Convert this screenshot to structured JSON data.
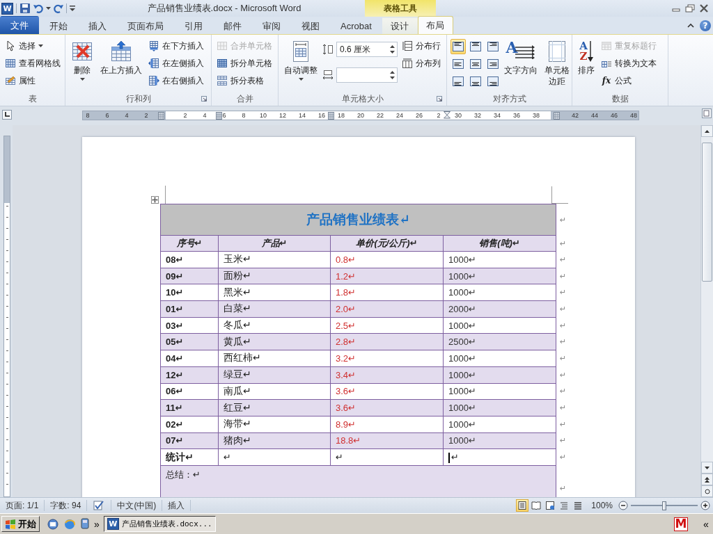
{
  "title_bar": {
    "app_icon": "W",
    "title": "产品销售业绩表.docx - Microsoft Word",
    "context_label": "表格工具"
  },
  "tabs": [
    {
      "label": "文件",
      "kind": "file",
      "selected": false
    },
    {
      "label": "开始",
      "kind": "main",
      "selected": false
    },
    {
      "label": "插入",
      "kind": "main",
      "selected": false
    },
    {
      "label": "页面布局",
      "kind": "main",
      "selected": false
    },
    {
      "label": "引用",
      "kind": "main",
      "selected": false
    },
    {
      "label": "邮件",
      "kind": "main",
      "selected": false
    },
    {
      "label": "审阅",
      "kind": "main",
      "selected": false
    },
    {
      "label": "视图",
      "kind": "main",
      "selected": false
    },
    {
      "label": "Acrobat",
      "kind": "main",
      "selected": false
    },
    {
      "label": "设计",
      "kind": "context",
      "selected": false
    },
    {
      "label": "布局",
      "kind": "context",
      "selected": true
    }
  ],
  "help_glyph": "?",
  "ribbon": {
    "groups": [
      {
        "label": "表",
        "launcher": false,
        "columns": [
          [
            {
              "kind": "small",
              "label": "选择",
              "dropdown": true,
              "disabled": false
            },
            {
              "kind": "small",
              "label": "查看网格线",
              "dropdown": false,
              "disabled": false
            },
            {
              "kind": "small",
              "label": "属性",
              "dropdown": false,
              "disabled": false
            }
          ]
        ]
      },
      {
        "label": "行和列",
        "launcher": true,
        "columns": [
          [
            {
              "kind": "large",
              "label": "删除",
              "dropdown": true,
              "disabled": false
            }
          ],
          [
            {
              "kind": "large",
              "label": "在上方插入",
              "dropdown": false,
              "disabled": false
            }
          ],
          [
            {
              "kind": "small",
              "label": "在下方插入",
              "dropdown": false,
              "disabled": false
            },
            {
              "kind": "small",
              "label": "在左侧插入",
              "dropdown": false,
              "disabled": false
            },
            {
              "kind": "small",
              "label": "在右侧插入",
              "dropdown": false,
              "disabled": false
            }
          ]
        ]
      },
      {
        "label": "合并",
        "launcher": false,
        "columns": [
          [
            {
              "kind": "small",
              "label": "合并单元格",
              "dropdown": false,
              "disabled": true
            },
            {
              "kind": "small",
              "label": "拆分单元格",
              "dropdown": false,
              "disabled": false
            },
            {
              "kind": "small",
              "label": "拆分表格",
              "dropdown": false,
              "disabled": false
            }
          ]
        ]
      },
      {
        "label": "单元格大小",
        "launcher": true,
        "columns": [
          [
            {
              "kind": "large",
              "label": "自动调整",
              "dropdown": true,
              "disabled": false
            }
          ],
          [
            {
              "kind": "spin",
              "value": "0.6 厘米"
            },
            {
              "kind": "spin"
            }
          ],
          [
            {
              "kind": "small",
              "label": "分布行",
              "dropdown": false,
              "disabled": false
            },
            {
              "kind": "small",
              "label": "分布列",
              "dropdown": false,
              "disabled": false
            }
          ]
        ]
      },
      {
        "label": "对齐方式",
        "launcher": false,
        "columns": [
          [
            {
              "kind": "align-grid",
              "cells": [
                {
                  "selected": true
                },
                {
                  "selected": false
                },
                {
                  "selected": false
                },
                {
                  "selected": false
                },
                {
                  "selected": false
                },
                {
                  "selected": false
                },
                {
                  "selected": false
                },
                {
                  "selected": false
                },
                {
                  "selected": false
                }
              ]
            }
          ],
          [
            {
              "kind": "large",
              "label": "文字方向",
              "glyphs": [
                "A"
              ],
              "dropdown": false,
              "disabled": false
            }
          ],
          [
            {
              "kind": "large",
              "label": "单元格边距",
              "dropdown": false,
              "disabled": false
            }
          ]
        ]
      },
      {
        "label": "数据",
        "launcher": false,
        "columns": [
          [
            {
              "kind": "large",
              "label": "排序",
              "glyphs": [
                "A",
                "Z"
              ],
              "dropdown": false,
              "disabled": false
            }
          ],
          [
            {
              "kind": "small",
              "label": "重复标题行",
              "dropdown": false,
              "disabled": true
            },
            {
              "kind": "small",
              "label": "转换为文本",
              "dropdown": false,
              "disabled": false
            },
            {
              "kind": "small",
              "label": "公式",
              "glyphs": [
                "fx"
              ],
              "dropdown": false,
              "disabled": false
            }
          ]
        ]
      }
    ]
  },
  "ruler": {
    "labels": [
      "8",
      "6",
      "4",
      "2",
      "2",
      "4",
      "6",
      "8",
      "10",
      "12",
      "14",
      "16",
      "18",
      "20",
      "22",
      "24",
      "26",
      "2",
      "30",
      "32",
      "34",
      "36",
      "38",
      "42",
      "44",
      "46",
      "48"
    ]
  },
  "document": {
    "table": {
      "title": {
        "text": "产品销售业绩表↵",
        "end_mark": "↵"
      },
      "header": {
        "cells": [
          "序号↵",
          "产品↵",
          "单价(元/公斤)↵",
          "销售(吨)↵"
        ],
        "end_mark": "↵"
      },
      "rows": [
        {
          "cells": [
            "08↵",
            "玉米↵",
            "0.8↵",
            "1000↵"
          ],
          "shaded": false,
          "end_mark": "↵"
        },
        {
          "cells": [
            "09↵",
            "面粉↵",
            "1.2↵",
            "1000↵"
          ],
          "shaded": true,
          "end_mark": "↵"
        },
        {
          "cells": [
            "10↵",
            "黑米↵",
            "1.8↵",
            "1000↵"
          ],
          "shaded": false,
          "end_mark": "↵"
        },
        {
          "cells": [
            "01↵",
            "白菜↵",
            "2.0↵",
            "2000↵"
          ],
          "shaded": true,
          "end_mark": "↵"
        },
        {
          "cells": [
            "03↵",
            "冬瓜↵",
            "2.5↵",
            "1000↵"
          ],
          "shaded": false,
          "end_mark": "↵"
        },
        {
          "cells": [
            "05↵",
            "黄瓜↵",
            "2.8↵",
            "2500↵"
          ],
          "shaded": true,
          "end_mark": "↵"
        },
        {
          "cells": [
            "04↵",
            "西红柿↵",
            "3.2↵",
            "1000↵"
          ],
          "shaded": false,
          "end_mark": "↵"
        },
        {
          "cells": [
            "12↵",
            "绿豆↵",
            "3.4↵",
            "1000↵"
          ],
          "shaded": true,
          "end_mark": "↵"
        },
        {
          "cells": [
            "06↵",
            "南瓜↵",
            "3.6↵",
            "1000↵"
          ],
          "shaded": false,
          "end_mark": "↵"
        },
        {
          "cells": [
            "11↵",
            "红豆↵",
            "3.6↵",
            "1000↵"
          ],
          "shaded": true,
          "end_mark": "↵"
        },
        {
          "cells": [
            "02↵",
            "海带↵",
            "8.9↵",
            "1000↵"
          ],
          "shaded": false,
          "end_mark": "↵"
        },
        {
          "cells": [
            "07↵",
            "猪肉↵",
            "18.8↵",
            "1000↵"
          ],
          "shaded": true,
          "end_mark": "↵"
        }
      ],
      "total_row": {
        "cells": [
          {
            "text": "统计↵",
            "cursor": false
          },
          {
            "text": "↵",
            "cursor": false
          },
          {
            "text": "↵",
            "cursor": false
          },
          {
            "text": "↵",
            "cursor": true
          }
        ],
        "end_mark": "↵"
      },
      "summary": {
        "text": "总结：↵",
        "end_mark": "↵"
      }
    }
  },
  "status_bar": {
    "items": [
      {
        "kind": "text",
        "label": "页面: 1/1"
      },
      {
        "kind": "text",
        "label": "字数: 94"
      },
      {
        "kind": "proofing"
      },
      {
        "kind": "text",
        "label": "中文(中国)"
      },
      {
        "kind": "text",
        "label": "插入"
      }
    ],
    "views": [
      {
        "selected": true
      },
      {
        "selected": false
      },
      {
        "selected": false
      },
      {
        "selected": false
      },
      {
        "selected": false
      }
    ],
    "zoom": "100%",
    "zoom_slider": {
      "level": 0.5
    }
  },
  "taskbar": {
    "start": "开始",
    "more": "»",
    "tasks": [
      {
        "icon": "W",
        "label": "产品销售业绩表.docx...",
        "selected": true
      }
    ],
    "tray": [
      {
        "glyph": "M"
      }
    ],
    "tray_toggle": "«"
  }
}
